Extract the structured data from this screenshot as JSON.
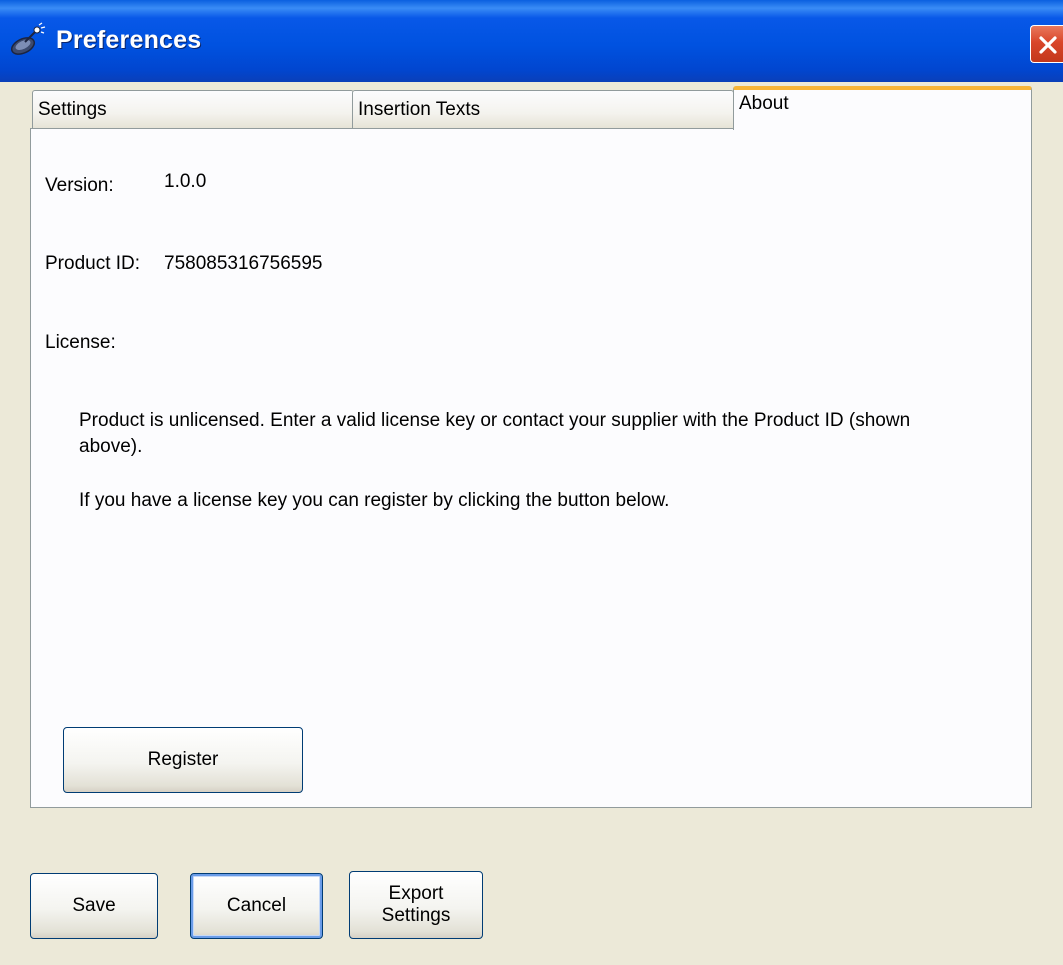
{
  "window": {
    "title": "Preferences",
    "icon": "satellite-icon",
    "close_icon": "close-icon",
    "accent_color": "#0052E0",
    "close_color": "#D9462A"
  },
  "tabs": [
    {
      "label": "Settings",
      "active": false
    },
    {
      "label": "Insertion Texts",
      "active": false
    },
    {
      "label": "About",
      "active": true
    }
  ],
  "about": {
    "version_label": "Version:",
    "version_value": "1.0.0",
    "product_id_label": "Product ID:",
    "product_id_value": "758085316756595",
    "license_label": "License:",
    "license_message": "Product is unlicensed. Enter a valid license key or contact your supplier with the Product ID (shown above).",
    "register_hint": "If you have a license key you can register by clicking the button below.",
    "register_button": "Register"
  },
  "footer": {
    "save_button": "Save",
    "cancel_button": "Cancel",
    "export_button_line1": "Export",
    "export_button_line2": "Settings"
  }
}
